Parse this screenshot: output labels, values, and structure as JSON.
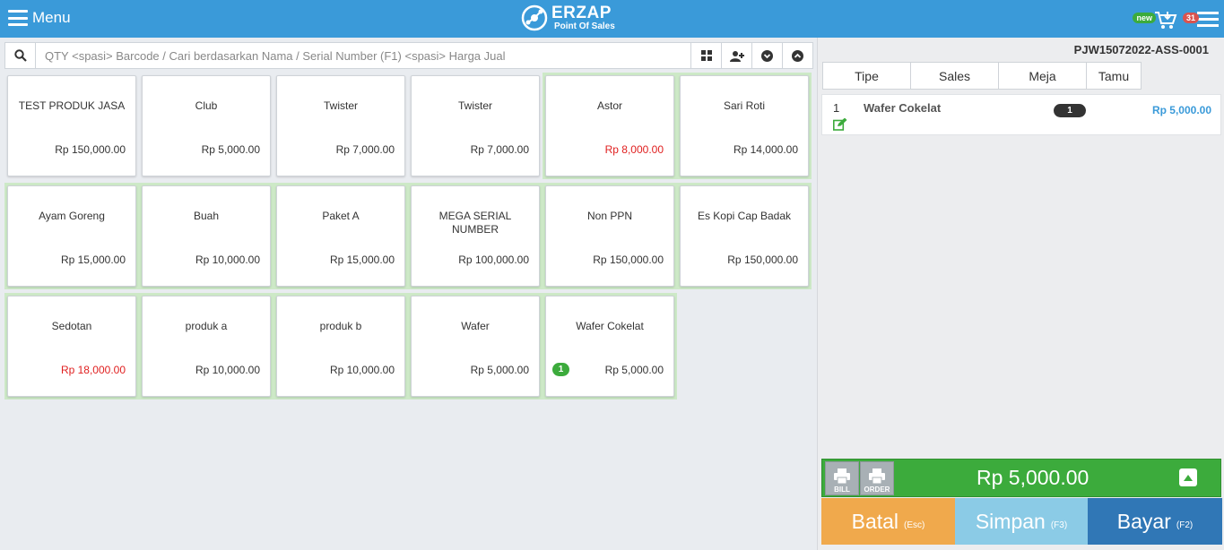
{
  "topbar": {
    "menu_label": "Menu",
    "logo_name": "ERZAP",
    "logo_sub": "Point Of Sales",
    "new_badge": "new",
    "count_badge": "31"
  },
  "search": {
    "placeholder": "QTY <spasi> Barcode / Cari berdasarkan Nama / Serial Number (F1) <spasi> Harga Jual"
  },
  "products": [
    [
      {
        "name": "TEST PRODUK JASA",
        "price": "Rp 150,000.00",
        "red": false,
        "green": false,
        "qty": ""
      },
      {
        "name": "Club",
        "price": "Rp 5,000.00",
        "red": false,
        "green": false,
        "qty": ""
      },
      {
        "name": "Twister",
        "price": "Rp 7,000.00",
        "red": false,
        "green": false,
        "qty": ""
      },
      {
        "name": "Twister",
        "price": "Rp 7,000.00",
        "red": false,
        "green": false,
        "qty": ""
      },
      {
        "name": "Astor",
        "price": "Rp 8,000.00",
        "red": true,
        "green": true,
        "qty": ""
      },
      {
        "name": "Sari Roti",
        "price": "Rp 14,000.00",
        "red": false,
        "green": true,
        "qty": ""
      }
    ],
    [
      {
        "name": "Ayam Goreng",
        "price": "Rp 15,000.00",
        "red": false,
        "green": true,
        "qty": ""
      },
      {
        "name": "Buah",
        "price": "Rp 10,000.00",
        "red": false,
        "green": true,
        "qty": ""
      },
      {
        "name": "Paket A",
        "price": "Rp 15,000.00",
        "red": false,
        "green": true,
        "qty": ""
      },
      {
        "name": "MEGA SERIAL NUMBER",
        "price": "Rp 100,000.00",
        "red": false,
        "green": true,
        "qty": ""
      },
      {
        "name": "Non PPN",
        "price": "Rp 150,000.00",
        "red": false,
        "green": true,
        "qty": ""
      },
      {
        "name": "Es Kopi Cap Badak",
        "price": "Rp 150,000.00",
        "red": false,
        "green": true,
        "qty": ""
      }
    ],
    [
      {
        "name": "Sedotan",
        "price": "Rp 18,000.00",
        "red": true,
        "green": true,
        "qty": ""
      },
      {
        "name": "produk a",
        "price": "Rp 10,000.00",
        "red": false,
        "green": true,
        "qty": ""
      },
      {
        "name": "produk b",
        "price": "Rp 10,000.00",
        "red": false,
        "green": true,
        "qty": ""
      },
      {
        "name": "Wafer",
        "price": "Rp 5,000.00",
        "red": false,
        "green": true,
        "qty": ""
      },
      {
        "name": "Wafer Cokelat",
        "price": "Rp 5,000.00",
        "red": false,
        "green": true,
        "qty": "1"
      }
    ]
  ],
  "right": {
    "transaction_no": "PJW15072022-ASS-0001",
    "tabs": [
      "Tipe",
      "Sales",
      "Meja",
      "Tamu"
    ],
    "order_items": [
      {
        "no": "1",
        "name": "Wafer Cokelat",
        "qty": "1",
        "price": "Rp 5,000.00"
      }
    ],
    "print_bill": "BILL",
    "print_order": "ORDER",
    "total": "Rp 5,000.00",
    "actions": {
      "batal": "Batal",
      "batal_key": "(Esc)",
      "simpan": "Simpan",
      "simpan_key": "(F3)",
      "bayar": "Bayar",
      "bayar_key": "(F2)"
    }
  },
  "colors": {
    "topbar": "#3a9ad9",
    "green": "#3cab3c",
    "price_red": "#e02020",
    "batal": "#f0a94c",
    "simpan": "#8bcbe6",
    "bayar": "#3077b6"
  }
}
